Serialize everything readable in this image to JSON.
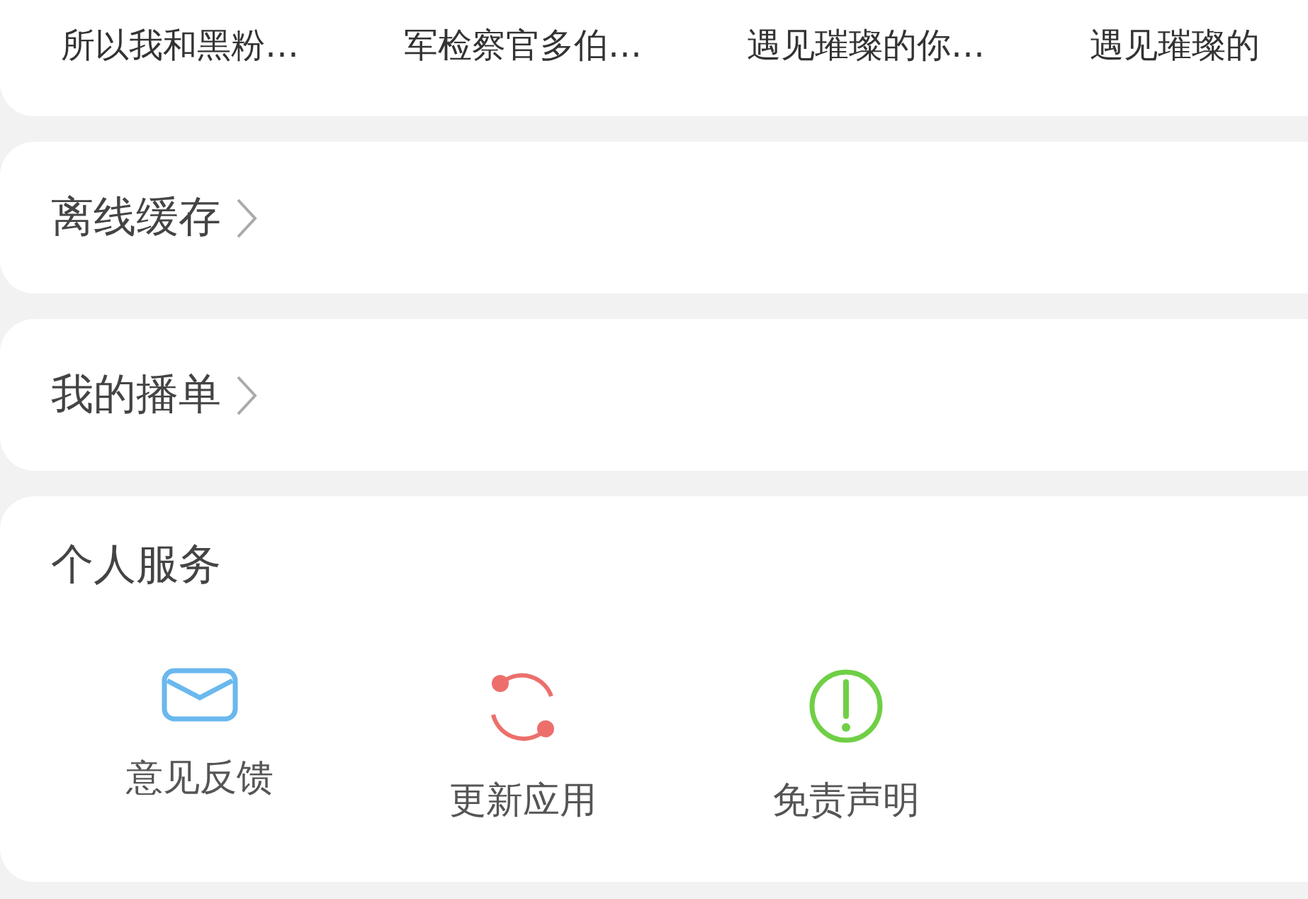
{
  "recent_titles": [
    "所以我和黑粉…",
    "军检察官多伯…",
    "遇见璀璨的你…",
    "遇见璀璨的"
  ],
  "menu_items": [
    {
      "label": "离线缓存"
    },
    {
      "label": "我的播单"
    }
  ],
  "personal_services": {
    "title": "个人服务",
    "items": [
      {
        "label": "意见反馈",
        "kind": "mail"
      },
      {
        "label": "更新应用",
        "kind": "update"
      },
      {
        "label": "免责声明",
        "kind": "notice"
      }
    ]
  }
}
